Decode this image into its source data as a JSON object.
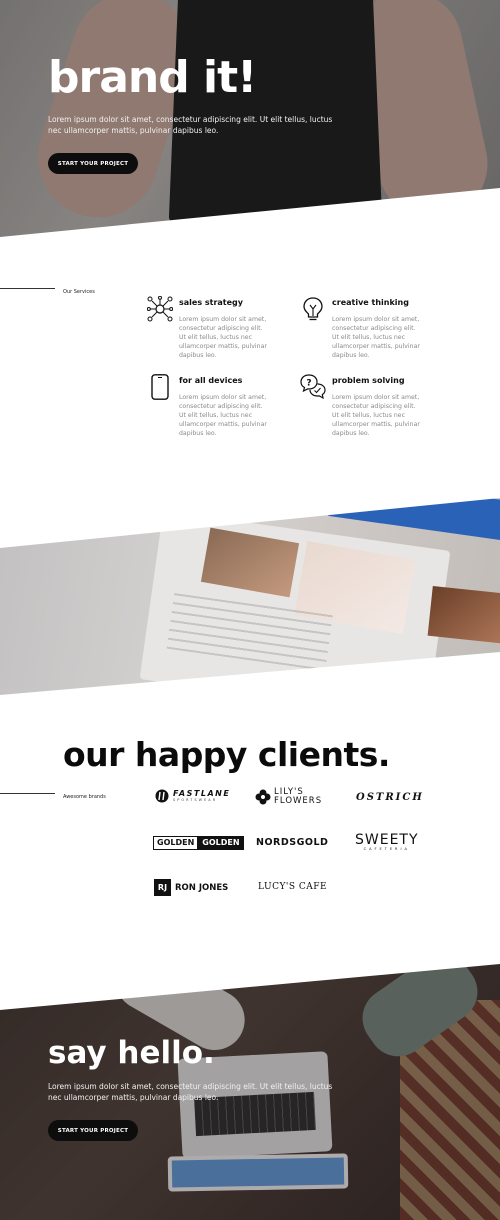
{
  "hero": {
    "title": "brand it!",
    "text": "Lorem ipsum dolor sit amet, consectetur adipiscing elit. Ut elit tellus, luctus nec ullamcorper mattis, pulvinar dapibus leo.",
    "button_label": "START YOUR PROJECT"
  },
  "services": {
    "section_label": "Our Services",
    "items": [
      {
        "title": "sales strategy",
        "icon": "network-icon",
        "text": "Lorem ipsum dolor sit amet, consectetur adipiscing elit. Ut elit tellus, luctus nec ullamcorper mattis, pulvinar dapibus leo."
      },
      {
        "title": "creative thinking",
        "icon": "lightbulb-icon",
        "text": "Lorem ipsum dolor sit amet, consectetur adipiscing elit. Ut elit tellus, luctus nec ullamcorper mattis, pulvinar dapibus leo."
      },
      {
        "title": "for all devices",
        "icon": "smartphone-icon",
        "text": "Lorem ipsum dolor sit amet, consectetur adipiscing elit. Ut elit tellus, luctus nec ullamcorper mattis, pulvinar dapibus leo."
      },
      {
        "title": "problem solving",
        "icon": "chat-bubbles-icon",
        "text": "Lorem ipsum dolor sit amet, consectetur adipiscing elit. Ut elit tellus, luctus nec ullamcorper mattis, pulvinar dapibus leo."
      }
    ]
  },
  "clients": {
    "title": "our happy clients.",
    "section_label": "Awesome brands",
    "logos": [
      {
        "name": "FASTLANE",
        "sub": "SPORTSWEAR"
      },
      {
        "name": "LILY'S",
        "name2": "FLOWERS"
      },
      {
        "name": "OSTRICH"
      },
      {
        "name": "GOLDEN",
        "name2": "GOLDEN"
      },
      {
        "name": "NORDSGOLD"
      },
      {
        "name": "SWEETY",
        "sub": "CAFETERIA"
      },
      {
        "name": "RJ",
        "name2": "RON JONES"
      },
      {
        "name": "LUCY'S CAFE"
      }
    ]
  },
  "contact": {
    "title": "say hello.",
    "text": "Lorem ipsum dolor sit amet, consectetur adipiscing elit. Ut elit tellus, luctus nec ullamcorper mattis, pulvinar dapibus leo.",
    "button_label": "START YOUR PROJECT"
  },
  "colors": {
    "accent": "#0d0d0d",
    "text_muted": "#8a8a8a",
    "background": "#ffffff"
  }
}
